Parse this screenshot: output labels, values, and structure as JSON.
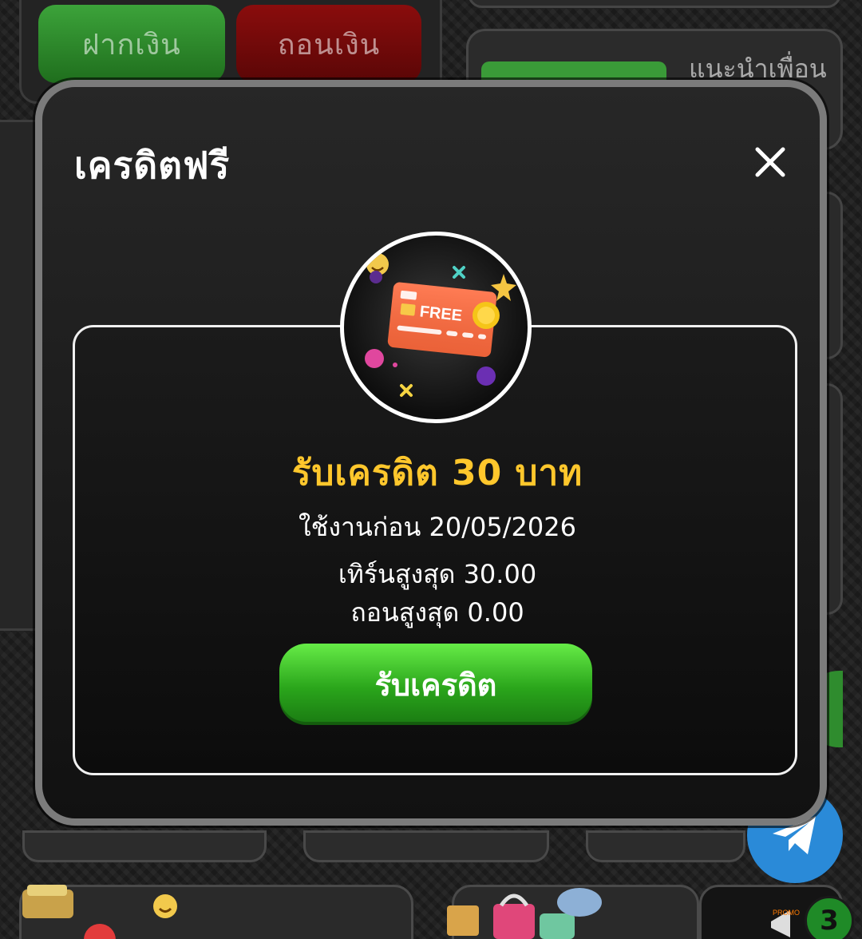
{
  "background": {
    "deposit_label": "ฝากเงิน",
    "withdraw_label": "ถอนเงิน",
    "refer_label": "แนะนำเพื่อน",
    "notification_count": "3"
  },
  "modal": {
    "title": "เครดิตฟรี",
    "close_icon": "close-icon",
    "promo_image_icon": "free-credit-card-icon",
    "promo_card_text": "FREE",
    "reward_title": "รับเครดิต 30 บาท",
    "expire_text": "ใช้งานก่อน 20/05/2026",
    "turnover_text": "เทิร์นสูงสุด 30.00",
    "max_withdraw_text": "ถอนสูงสุด 0.00",
    "claim_button_label": "รับเครดิต"
  },
  "colors": {
    "reward_title": "#ffc72c",
    "claim_button": "#3cc928",
    "deposit_button": "#2f8c2e",
    "withdraw_button": "#7a0a0a",
    "telegram": "#2a8ad8"
  }
}
